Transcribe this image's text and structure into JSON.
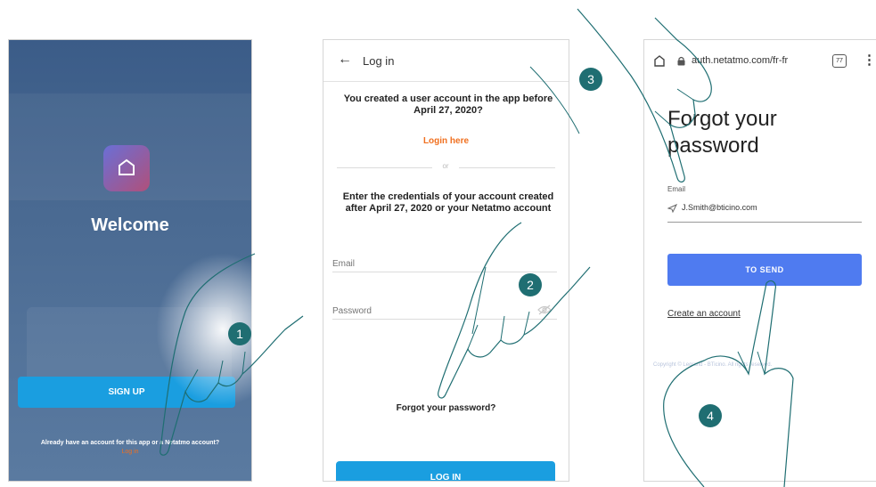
{
  "screen1": {
    "welcome": "Welcome",
    "signup_label": "SIGN UP",
    "account_text": "Already have an account for this app or a Netatmo account?",
    "login_link": "Log in"
  },
  "screen2": {
    "back_icon": "arrow-left-icon",
    "title": "Log in",
    "created_text": "You created a user account in the app before April 27, 2020?",
    "login_here": "Login here",
    "or": "or",
    "enter_text": "Enter the credentials of your account created after April 27, 2020 or your Netatmo account",
    "email_placeholder": "Email",
    "password_placeholder": "Password",
    "forgot": "Forgot your password?",
    "login_button": "LOG IN"
  },
  "screen3": {
    "url": "auth.netatmo.com/fr-fr",
    "tab_count": "77",
    "menu_icon": "⋮",
    "title": "Forgot your password",
    "email_label": "Email",
    "email_value": "J.Smith@bticino.com",
    "send_button": "TO SEND",
    "create_account": "Create an account",
    "footer": "Copyright © Legrand - BTicino. All rights reserved."
  },
  "steps": [
    "1",
    "2",
    "3",
    "4"
  ],
  "colors": {
    "accent_blue": "#1a9ee0",
    "send_blue": "#4f7bf0",
    "link_orange": "#f07020",
    "step_teal": "#1f6e72"
  }
}
